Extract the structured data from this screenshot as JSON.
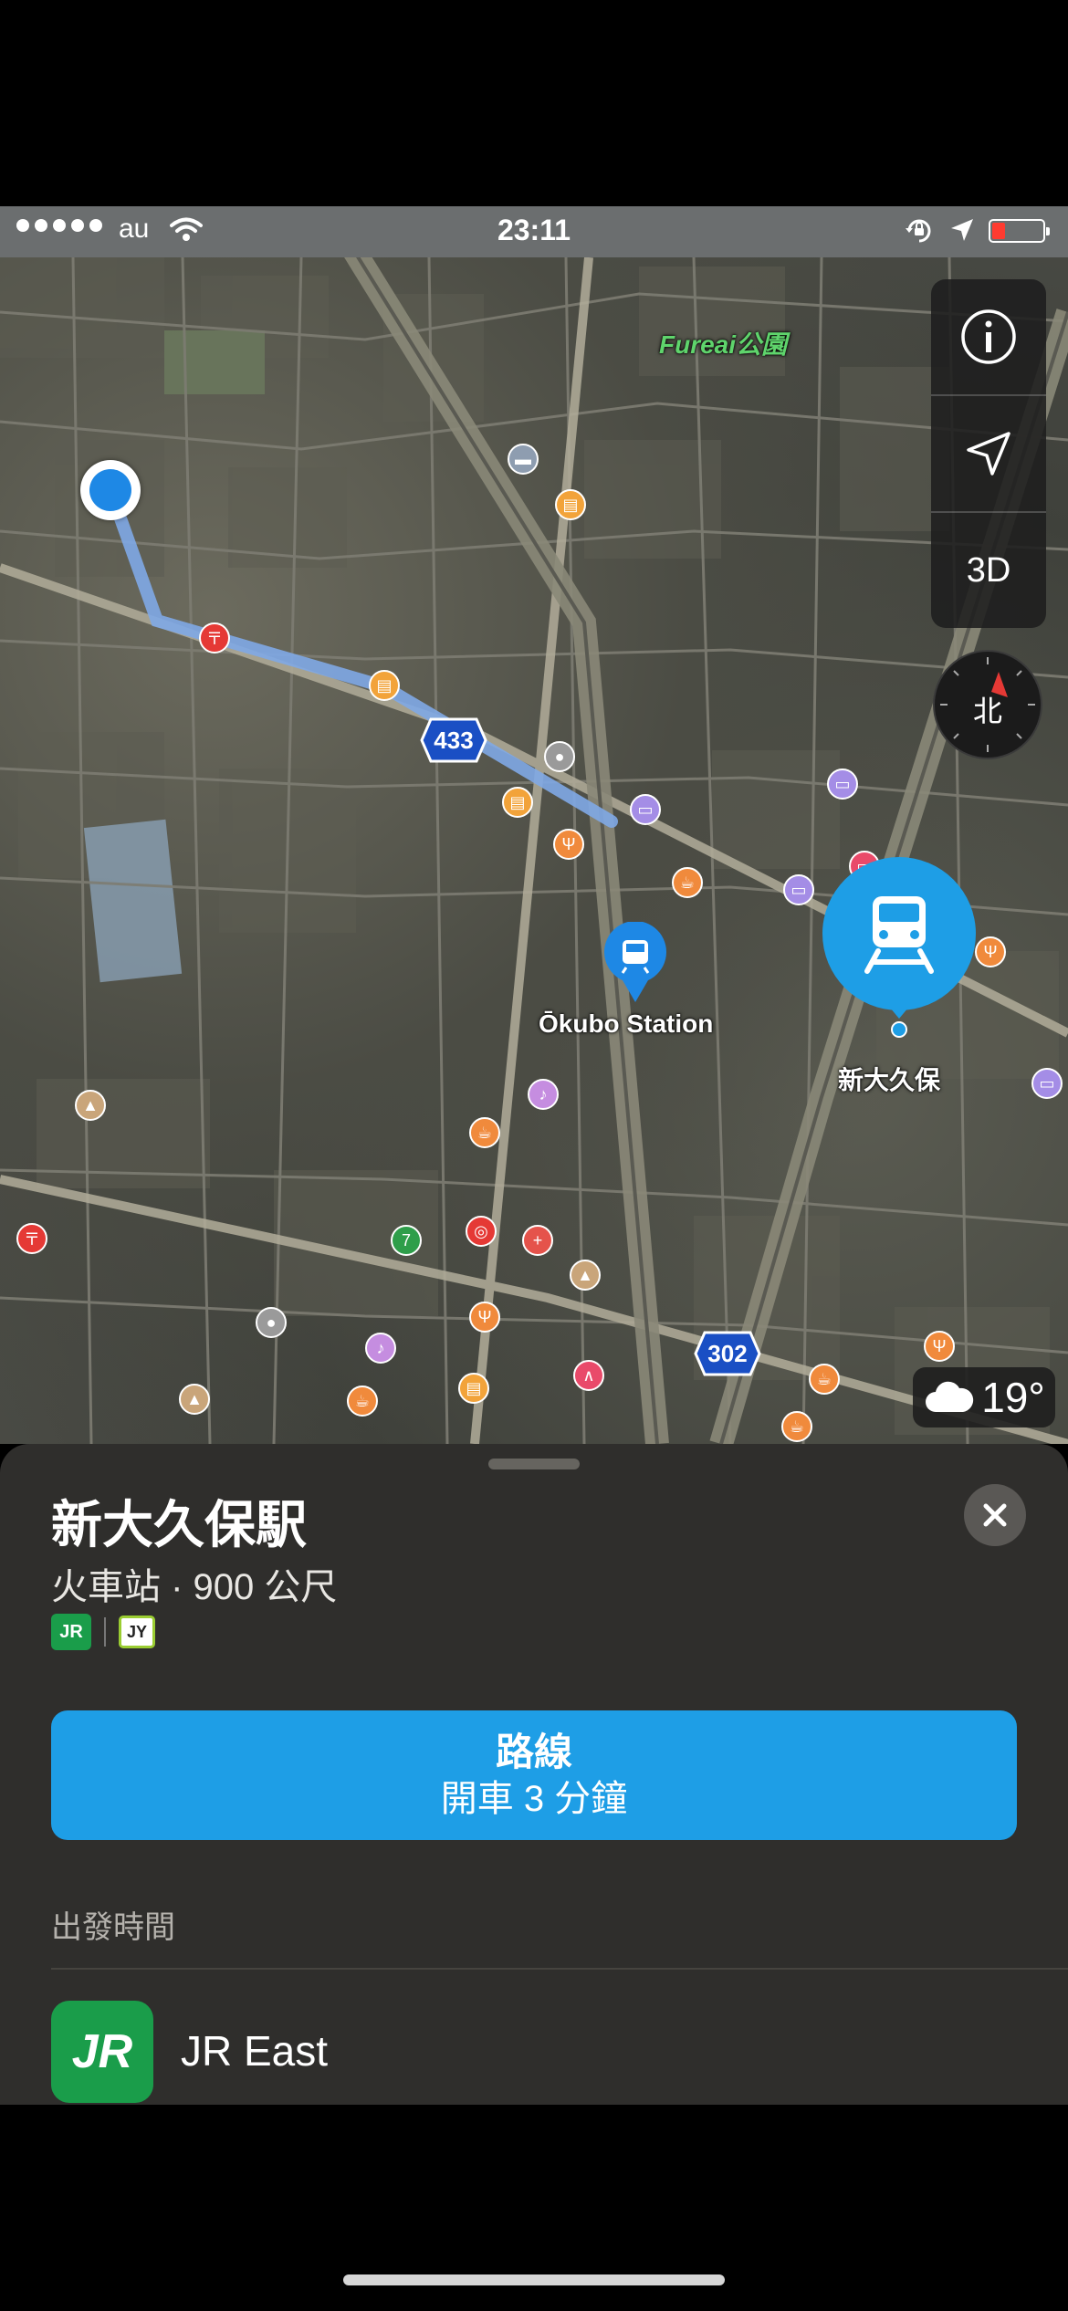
{
  "status_bar": {
    "carrier": "au",
    "time": "23:11",
    "signal_dots": 5
  },
  "map": {
    "park_label": "Fureai公園",
    "station_label": "Ōkubo Station",
    "selected_station_label": "新大久保",
    "route_433": "433",
    "route_302": "302"
  },
  "map_controls": {
    "info_icon": "info-icon",
    "location_icon": "location-arrow-icon",
    "mode_3d_label": "3D",
    "compass_label": "北"
  },
  "weather": {
    "temperature": "19°",
    "icon": "cloud-icon"
  },
  "card": {
    "title": "新大久保駅",
    "subtitle": "火車站 · 900 公尺",
    "badges": [
      "JR",
      "JY"
    ],
    "route_button": {
      "title": "路線",
      "detail": "開車 3 分鐘"
    },
    "section_title": "出發時間",
    "operator": {
      "logo": "JR",
      "name": "JR East"
    }
  },
  "colors": {
    "accent_blue": "#1e9ee6",
    "jr_green": "#1a9d4a",
    "card_background": "#2f2e2c"
  }
}
